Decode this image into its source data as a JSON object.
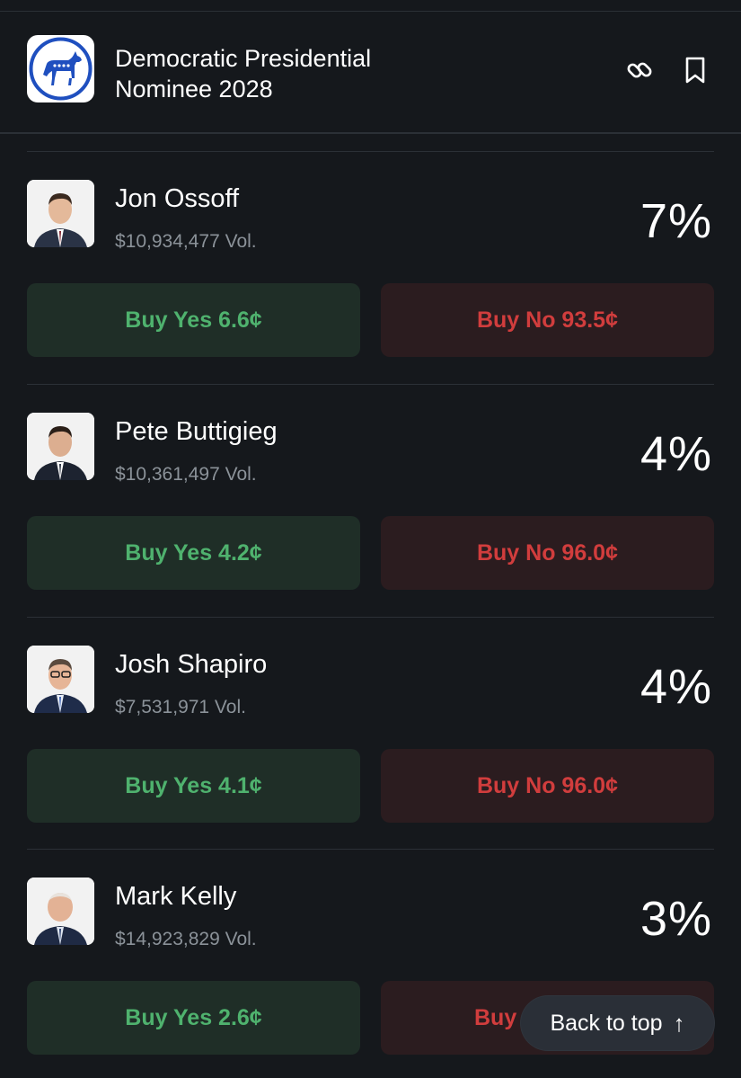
{
  "header": {
    "title_line1": "Democratic Presidential",
    "title_line2": "Nominee 2028",
    "logo_icon": "democratic-donkey-logo",
    "link_icon": "link-icon",
    "bookmark_icon": "bookmark-icon"
  },
  "candidates": [
    {
      "name": "Jon Ossoff",
      "volume": "$10,934,477 Vol.",
      "percent": "7%",
      "buy_yes": "Buy Yes 6.6¢",
      "buy_no": "Buy No 93.5¢"
    },
    {
      "name": "Pete Buttigieg",
      "volume": "$10,361,497 Vol.",
      "percent": "4%",
      "buy_yes": "Buy Yes 4.2¢",
      "buy_no": "Buy No 96.0¢"
    },
    {
      "name": "Josh Shapiro",
      "volume": "$7,531,971 Vol.",
      "percent": "4%",
      "buy_yes": "Buy Yes 4.1¢",
      "buy_no": "Buy No 96.0¢"
    },
    {
      "name": "Mark Kelly",
      "volume": "$14,923,829 Vol.",
      "percent": "3%",
      "buy_yes": "Buy Yes 2.6¢",
      "buy_no": "Buy"
    }
  ],
  "back_to_top": {
    "label": "Back to top",
    "arrow": "↑"
  },
  "colors": {
    "background": "#15181c",
    "yes_text": "#4fb26e",
    "yes_bg": "#1f2e27",
    "no_text": "#d13d3d",
    "no_bg": "#2b1c1f",
    "muted_text": "#8b9299"
  }
}
